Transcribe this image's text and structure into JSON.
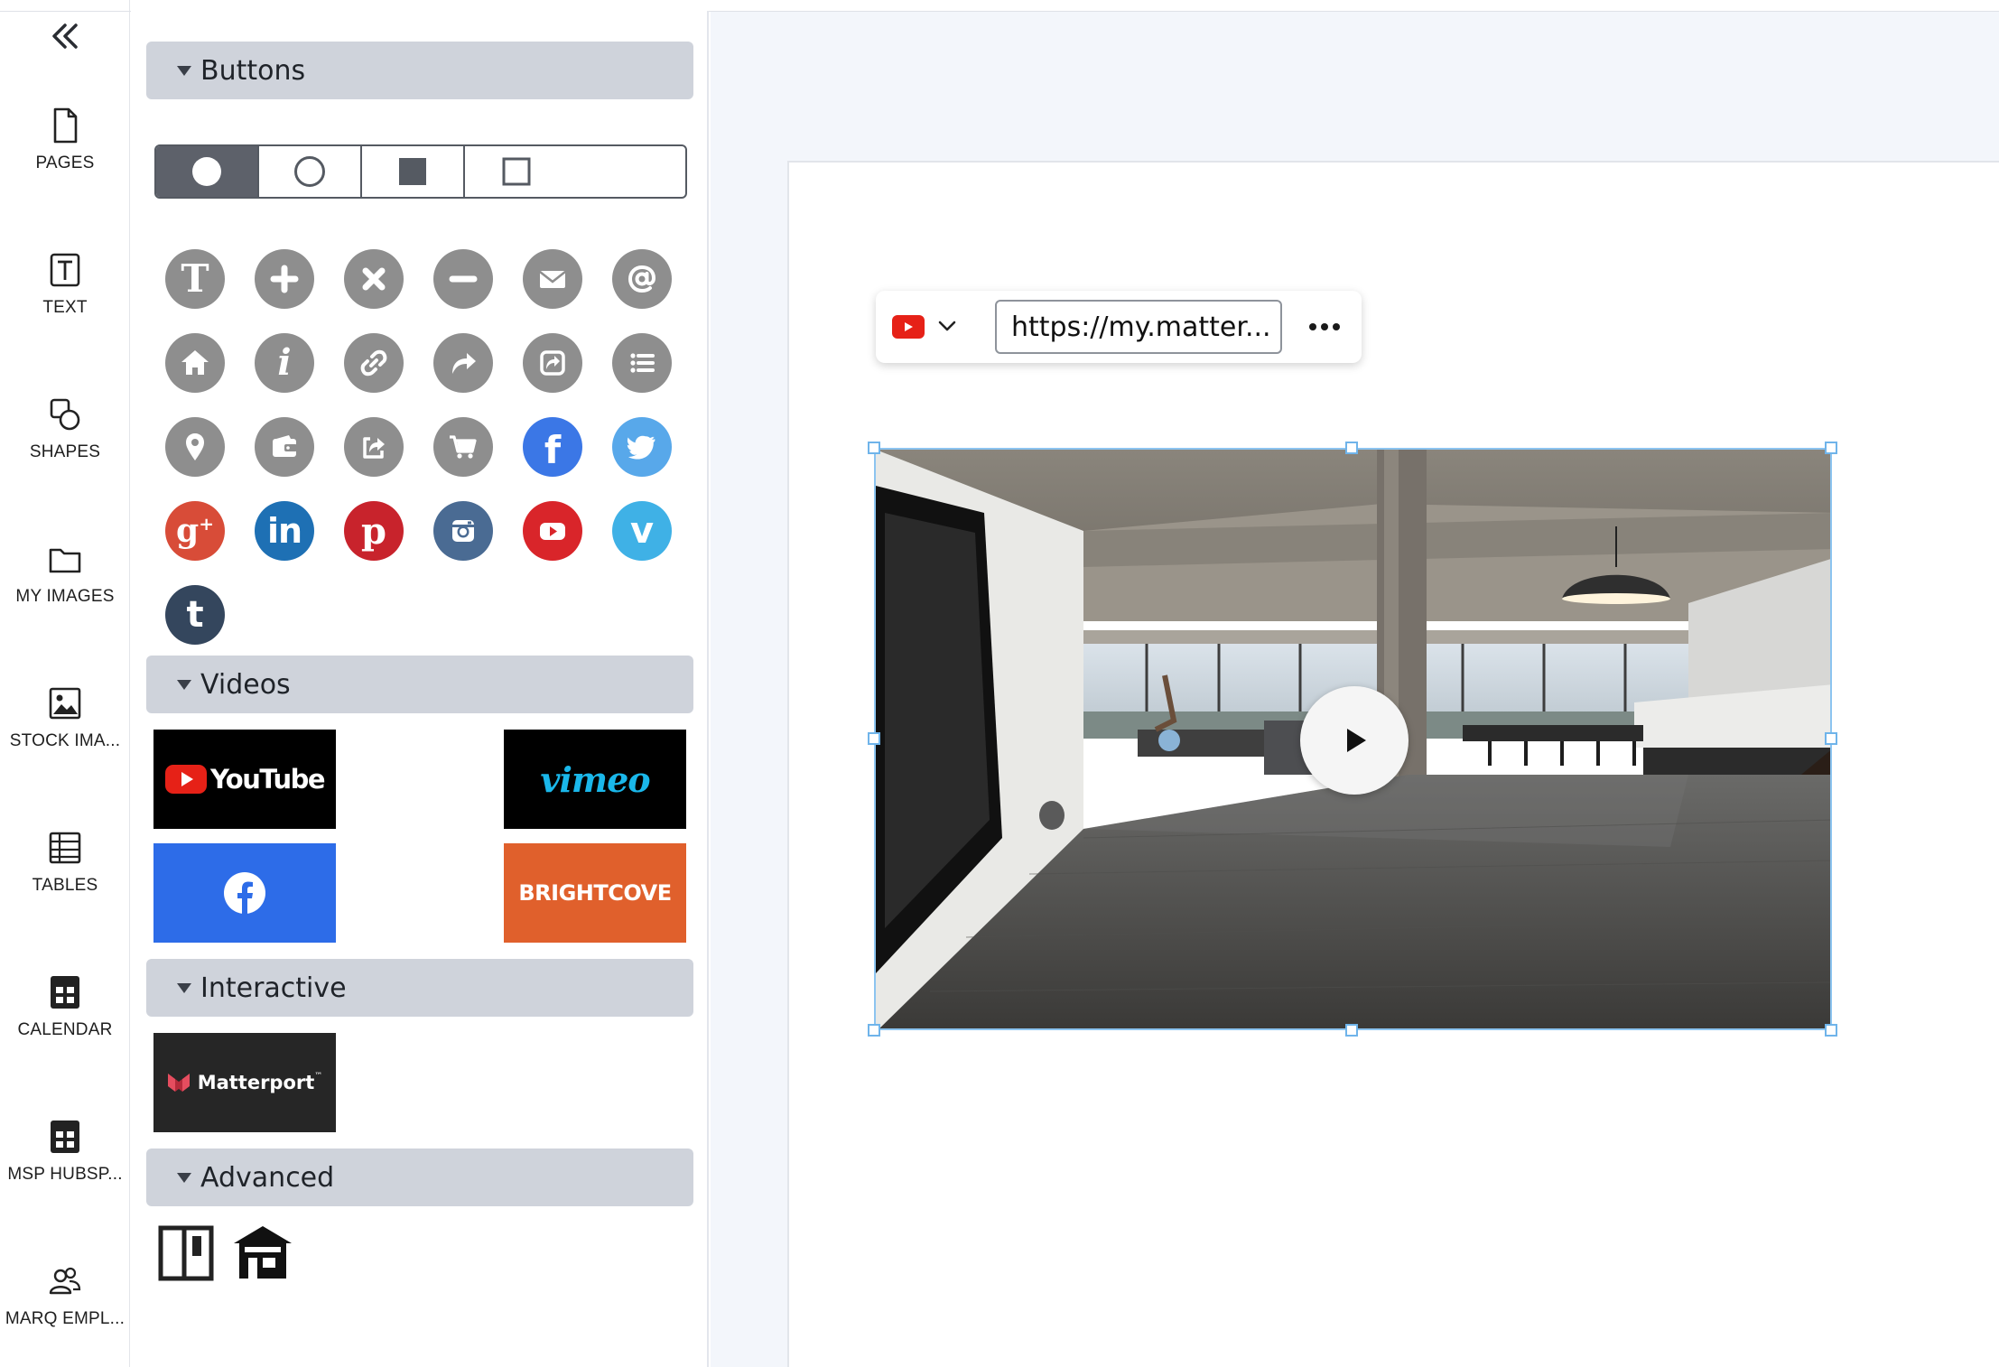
{
  "rail": {
    "collapse_icon": "double-chevron-left-icon",
    "items": [
      {
        "label": "PAGES",
        "icon": "page-icon"
      },
      {
        "label": "TEXT",
        "icon": "text-icon"
      },
      {
        "label": "SHAPES",
        "icon": "shapes-icon"
      },
      {
        "label": "MY IMAGES",
        "icon": "folder-icon"
      },
      {
        "label": "STOCK IMA...",
        "icon": "image-icon"
      },
      {
        "label": "TABLES",
        "icon": "table-icon"
      },
      {
        "label": "CALENDAR",
        "icon": "calendar-icon"
      },
      {
        "label": "MSP HUBSP...",
        "icon": "calendar-icon"
      },
      {
        "label": "MARQ EMPL...",
        "icon": "people-icon"
      }
    ]
  },
  "panel": {
    "sections": {
      "buttons": "Buttons",
      "videos": "Videos",
      "interactive": "Interactive",
      "advanced": "Advanced"
    },
    "shape_styles": [
      "filled-circle",
      "outline-circle",
      "filled-square",
      "outline-square"
    ],
    "button_icons": [
      {
        "icon": "text-t-icon",
        "color": "#8e8e8e"
      },
      {
        "icon": "plus-icon",
        "color": "#8e8e8e"
      },
      {
        "icon": "close-x-icon",
        "color": "#8e8e8e"
      },
      {
        "icon": "minus-icon",
        "color": "#8e8e8e"
      },
      {
        "icon": "envelope-icon",
        "color": "#8e8e8e"
      },
      {
        "icon": "at-icon",
        "color": "#8e8e8e"
      },
      {
        "icon": "home-icon",
        "color": "#8e8e8e"
      },
      {
        "icon": "info-icon",
        "color": "#8e8e8e"
      },
      {
        "icon": "link-icon",
        "color": "#8e8e8e"
      },
      {
        "icon": "share-arrow-icon",
        "color": "#8e8e8e"
      },
      {
        "icon": "share-box-icon",
        "color": "#8e8e8e"
      },
      {
        "icon": "list-icon",
        "color": "#8e8e8e"
      },
      {
        "icon": "location-pin-icon",
        "color": "#8e8e8e"
      },
      {
        "icon": "wallet-icon",
        "color": "#8e8e8e"
      },
      {
        "icon": "export-icon",
        "color": "#8e8e8e"
      },
      {
        "icon": "cart-icon",
        "color": "#8e8e8e"
      },
      {
        "icon": "facebook-icon",
        "color": "#3b77e6"
      },
      {
        "icon": "twitter-icon",
        "color": "#58a8ea"
      },
      {
        "icon": "google-plus-icon",
        "color": "#d84c38"
      },
      {
        "icon": "linkedin-icon",
        "color": "#1e70b4"
      },
      {
        "icon": "pinterest-icon",
        "color": "#c8232c"
      },
      {
        "icon": "instagram-icon",
        "color": "#4a6b93"
      },
      {
        "icon": "youtube-icon",
        "color": "#d9252a"
      },
      {
        "icon": "vimeo-icon",
        "color": "#3fb1e6"
      },
      {
        "icon": "tumblr-icon",
        "color": "#34465d"
      }
    ],
    "videos": {
      "youtube": "YouTube",
      "vimeo": "vimeo",
      "facebook_icon": "facebook-icon",
      "brightcove": "BRIGHTCOVE"
    },
    "interactive": {
      "matterport": "Matterport",
      "matterport_tm": "™"
    },
    "advanced": [
      {
        "icon": "layout-panel-icon"
      },
      {
        "icon": "building-icon"
      }
    ]
  },
  "toolbar": {
    "source_icon": "youtube-icon",
    "url": "https://my.matter..."
  },
  "colors": {
    "accent_selection": "#6fb4ea",
    "section_header": "#cfd3db",
    "workspace_bg": "#f3f6fb"
  }
}
